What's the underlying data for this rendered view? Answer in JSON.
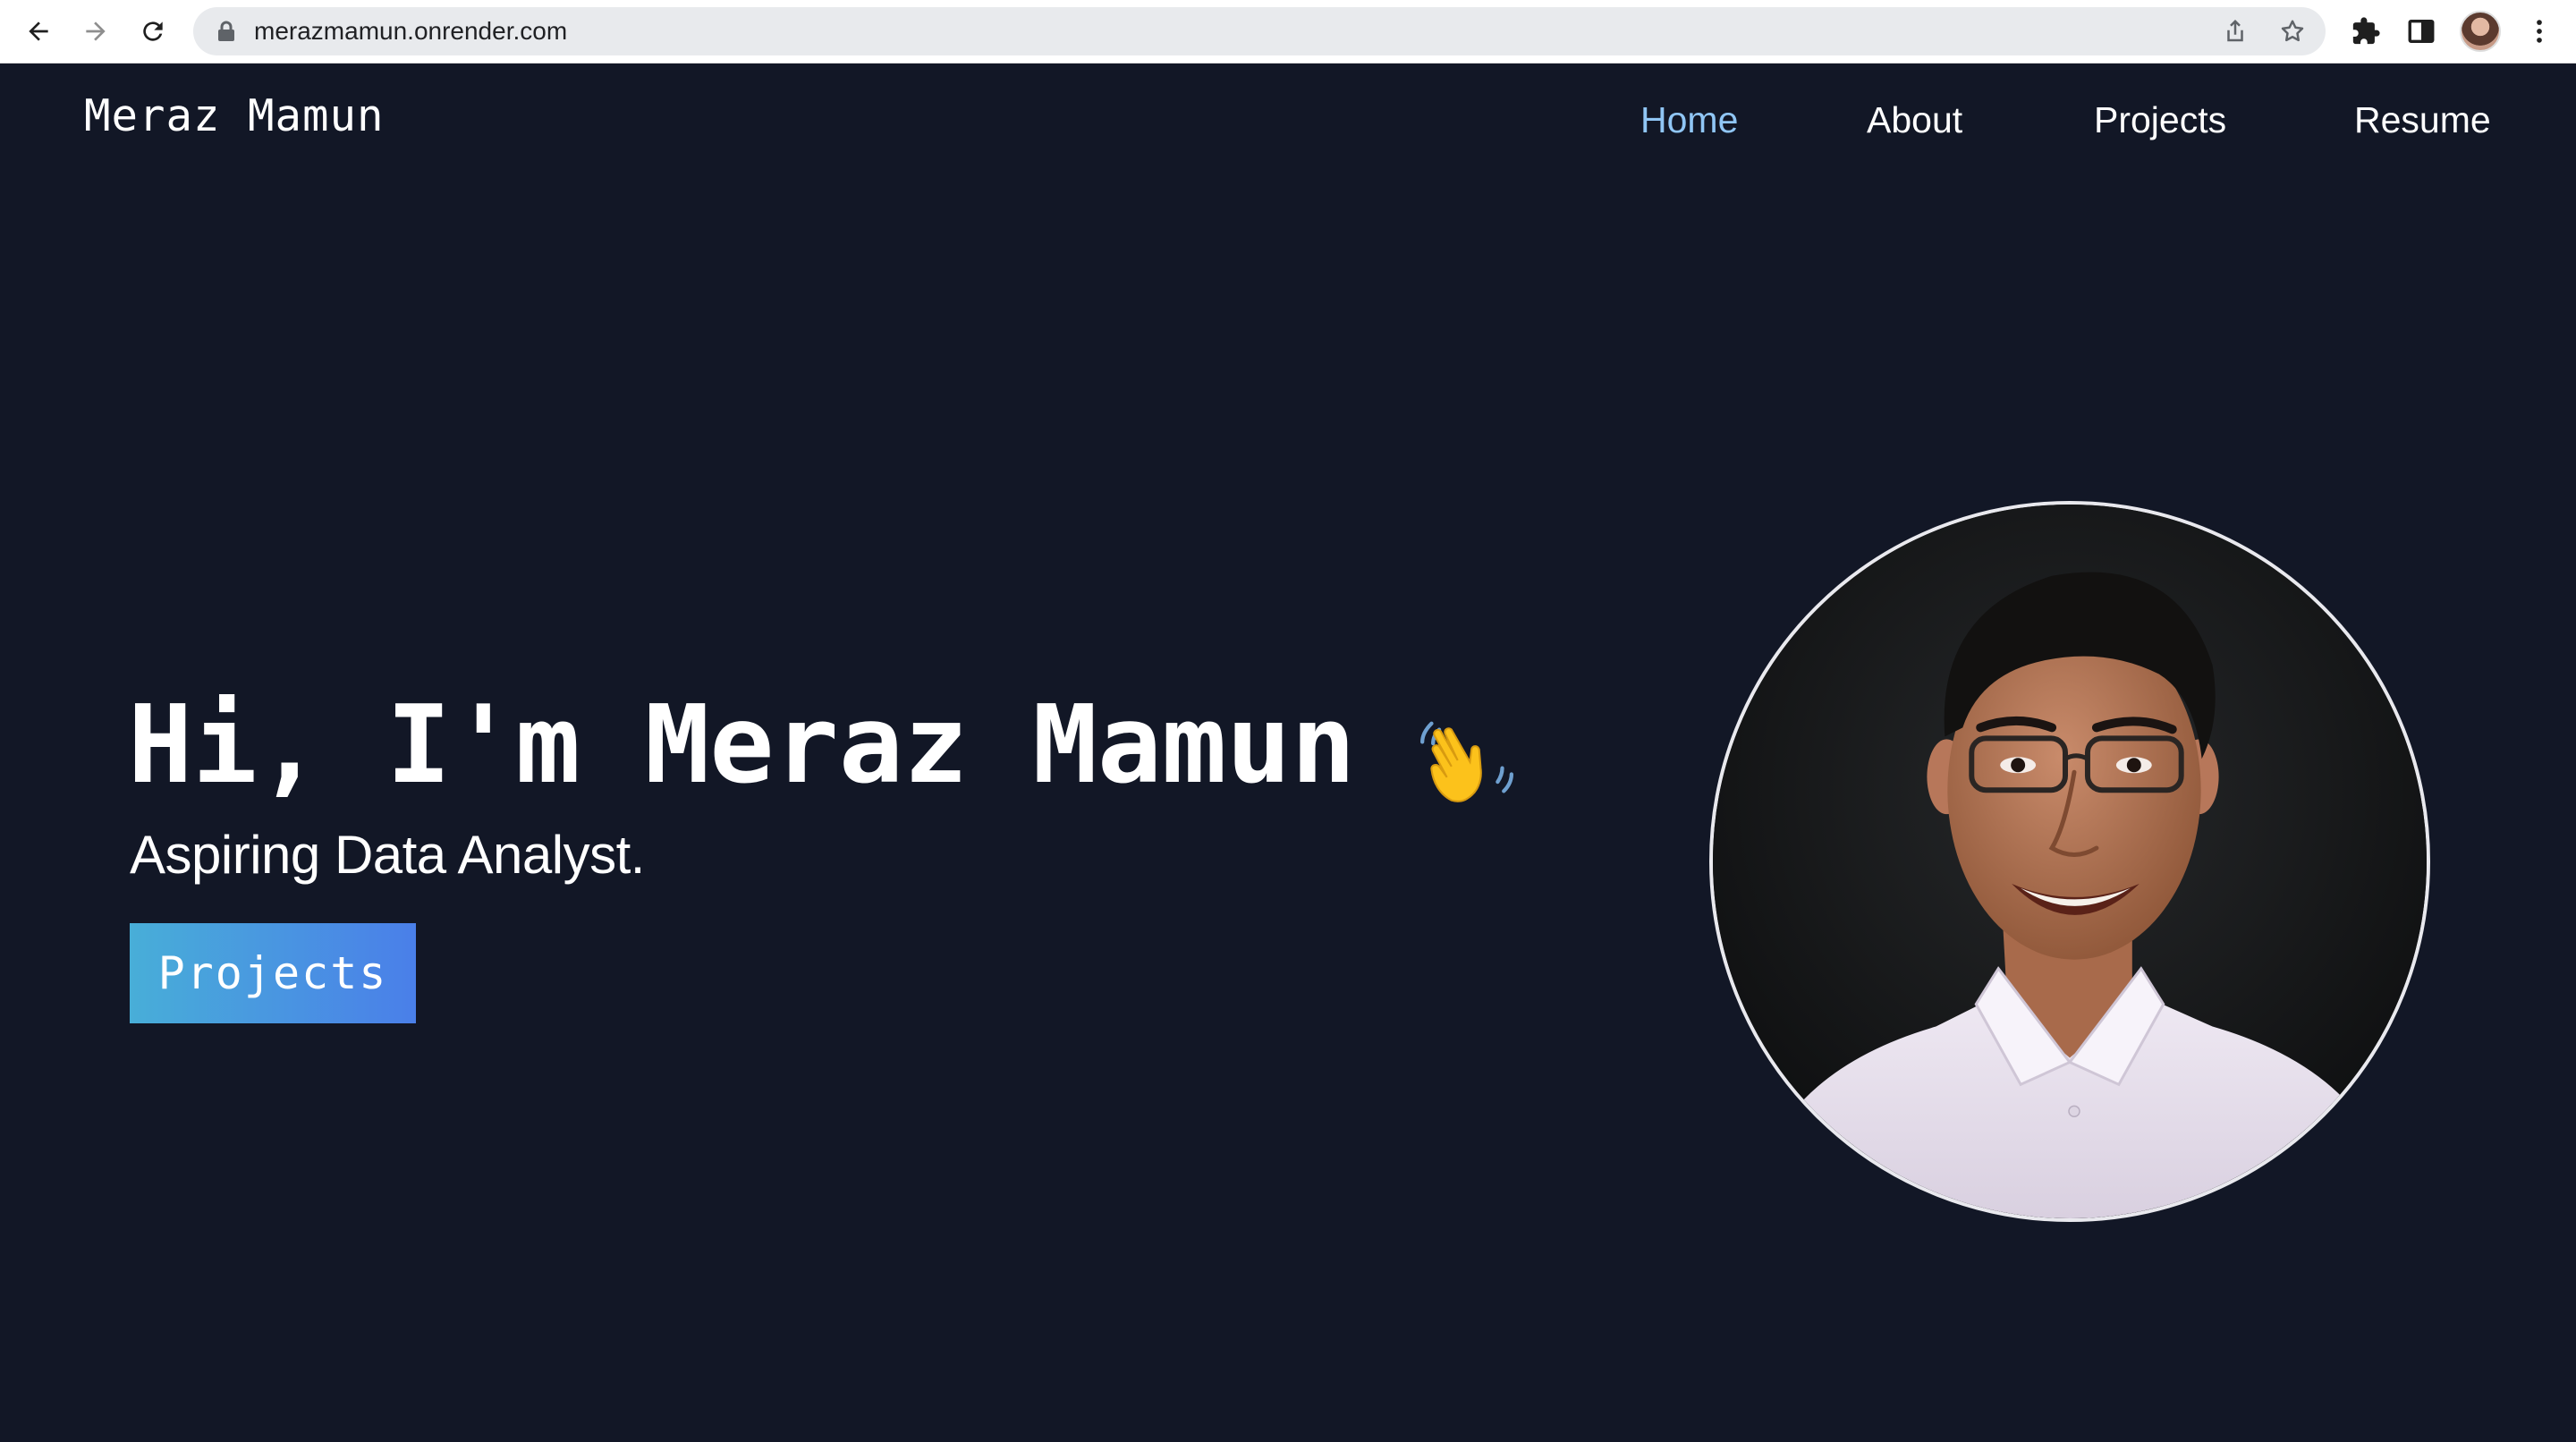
{
  "browser": {
    "url": "merazmamun.onrender.com",
    "icons": {
      "back": "arrow-left-icon",
      "forward": "arrow-right-icon",
      "reload": "reload-icon",
      "lock": "lock-icon",
      "share": "share-icon",
      "bookmark": "star-icon",
      "extensions": "puzzle-icon",
      "side_panel": "side-panel-icon",
      "profile": "profile-avatar",
      "menu": "kebab-menu-icon"
    }
  },
  "site": {
    "brand": "Meraz Mamun",
    "nav": [
      {
        "label": "Home",
        "active": true
      },
      {
        "label": "About",
        "active": false
      },
      {
        "label": "Projects",
        "active": false
      },
      {
        "label": "Resume",
        "active": false
      }
    ],
    "colors": {
      "background": "#121726",
      "active_link": "#90c6f5",
      "button_gradient_start": "#48aed8",
      "button_gradient_end": "#4a7fe9"
    }
  },
  "hero": {
    "greeting": "Hi, I'm Meraz Mamun",
    "emoji": "waving-hand-icon",
    "subtitle": "Aspiring Data Analyst.",
    "button_label": "Projects",
    "portrait": "portrait-photo"
  }
}
